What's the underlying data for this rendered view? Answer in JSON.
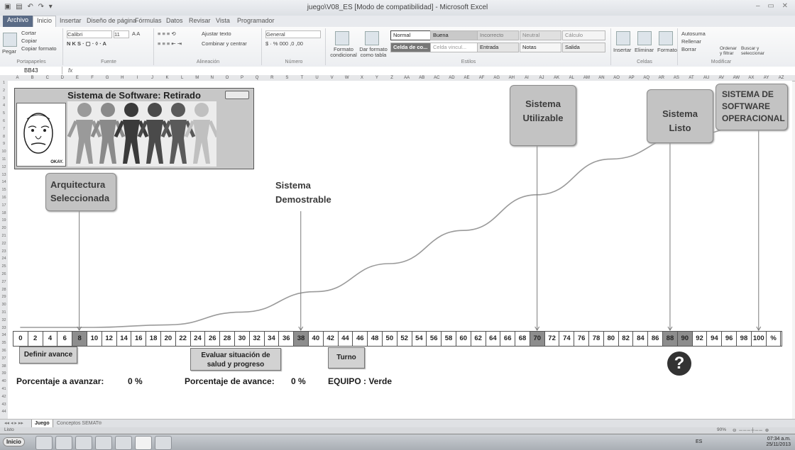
{
  "window": {
    "title": "juego\\V08_ES [Modo de compatibilidad] - Microsoft Excel"
  },
  "tabs": [
    "Archivo",
    "Inicio",
    "Insertar",
    "Diseño de página",
    "Fórmulas",
    "Datos",
    "Revisar",
    "Vista",
    "Programador"
  ],
  "ribbon": {
    "clipboard": {
      "cut": "Cortar",
      "copy": "Copiar",
      "painter": "Copiar formato",
      "paste": "Pegar",
      "label": "Portapapeles"
    },
    "font": {
      "name": "Calibri",
      "size": "11",
      "label": "Fuente"
    },
    "alignment": {
      "wrap": "Ajustar texto",
      "merge": "Combinar y centrar",
      "label": "Alineación"
    },
    "number": {
      "format": "General",
      "label": "Número"
    },
    "styles": {
      "conditional": "Formato condicional",
      "table": "Dar formato como tabla",
      "cells": [
        "Normal",
        "Buena",
        "Incorrecto",
        "Neutral",
        "Cálculo",
        "Celda de co...",
        "Celda vincul...",
        "Entrada",
        "Notas",
        "Salida"
      ],
      "label": "Estilos"
    },
    "cellsgroup": {
      "insert": "Insertar",
      "delete": "Eliminar",
      "format": "Formato",
      "label": "Celdas"
    },
    "editing": {
      "autosum": "Autosuma",
      "fill": "Rellenar",
      "clear": "Borrar",
      "sort": "Ordenar y filtrar",
      "find": "Buscar y seleccionar",
      "label": "Modificar"
    }
  },
  "formula_bar": {
    "cell": "BB43",
    "fx": "fx"
  },
  "columns": [
    "A",
    "B",
    "C",
    "D",
    "E",
    "F",
    "G",
    "H",
    "I",
    "J",
    "K",
    "L",
    "M",
    "N",
    "O",
    "P",
    "Q",
    "R",
    "S",
    "T",
    "U",
    "V",
    "W",
    "X",
    "Y",
    "Z",
    "AA",
    "AB",
    "AC",
    "AD",
    "AE",
    "AF",
    "AG",
    "AH",
    "AI",
    "AJ",
    "AK",
    "AL",
    "AM",
    "AN",
    "AO",
    "AP",
    "AQ",
    "AR",
    "AS",
    "AT",
    "AU",
    "AV",
    "AW",
    "AX",
    "AY",
    "AZ"
  ],
  "panel": {
    "title": "Sistema de Software: Retirado",
    "okay_caption": "OKAY."
  },
  "milestones": {
    "arquitectura": "Arquitectura Seleccionada",
    "demostrable": "Sistema Demostrable",
    "utilizable": "Sistema Utilizable",
    "listo": "Sistema Listo",
    "operacional": "SISTEMA DE SOFTWARE OPERACIONAL"
  },
  "chart_data": {
    "type": "line",
    "title": "",
    "xlabel": "",
    "ylabel": "",
    "x": [
      0,
      10,
      20,
      30,
      40,
      50,
      60,
      70,
      80,
      90,
      100
    ],
    "series": [
      {
        "values": [
          0,
          0,
          1,
          6,
          14,
          25,
          38,
          52,
          66,
          75,
          80
        ]
      }
    ],
    "milestone_x": [
      8,
      38,
      70,
      88,
      100
    ],
    "grid": false
  },
  "scale": {
    "values": [
      "0",
      "2",
      "4",
      "6",
      "8",
      "10",
      "12",
      "14",
      "16",
      "18",
      "20",
      "22",
      "24",
      "26",
      "28",
      "30",
      "32",
      "34",
      "36",
      "38",
      "40",
      "42",
      "44",
      "46",
      "48",
      "50",
      "52",
      "54",
      "56",
      "58",
      "60",
      "62",
      "64",
      "66",
      "68",
      "70",
      "72",
      "74",
      "76",
      "78",
      "80",
      "82",
      "84",
      "86",
      "88",
      "90",
      "92",
      "94",
      "96",
      "98",
      "100",
      "%"
    ],
    "highlighted": [
      "8",
      "38",
      "70",
      "88",
      "90"
    ]
  },
  "buttons": {
    "definir": "Definir avance",
    "evaluar": "Evaluar situación de salud y progreso",
    "turno": "Turno"
  },
  "status": {
    "porcentaje_avanzar_label": "Porcentaje a avanzar:",
    "porcentaje_avanzar_value": "0 %",
    "porcentaje_avance_label": "Porcentaje de avance:",
    "porcentaje_avance_value": "0 %",
    "equipo_label": "EQUIPO : Verde"
  },
  "sheet_tabs": [
    "Juego",
    "Conceptos SEMAT"
  ],
  "statusbar": {
    "mode": "Listo",
    "zoom": "90%"
  },
  "taskbar": {
    "start": "Inicio",
    "lang": "ES",
    "time": "07:34 a.m.",
    "date": "25/11/2013"
  }
}
